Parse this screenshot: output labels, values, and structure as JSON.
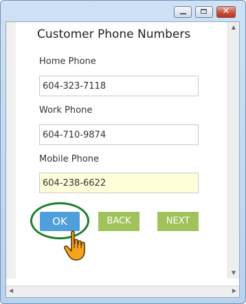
{
  "form": {
    "heading": "Customer Phone Numbers",
    "fields": [
      {
        "label": "Home Phone",
        "value": "604-323-7118"
      },
      {
        "label": "Work Phone",
        "value": "604-710-9874"
      },
      {
        "label": "Mobile Phone",
        "value": "604-238-6622"
      }
    ]
  },
  "buttons": {
    "ok": "OK",
    "back": "BACK",
    "next": "NEXT"
  },
  "icons": {
    "pointer": "hand-pointer-icon"
  },
  "colors": {
    "ok_button": "#4e9fdc",
    "nav_buttons": "#9fc25a",
    "focus_field": "#ffffd9",
    "highlight_ring": "#1b7f2c"
  }
}
